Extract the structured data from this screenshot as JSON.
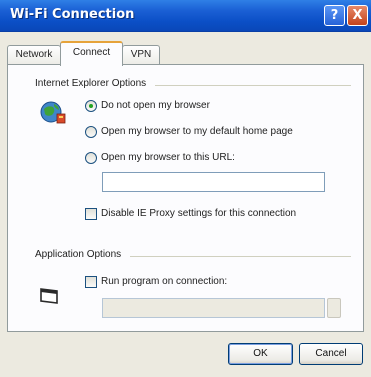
{
  "window": {
    "title": "Wi-Fi Connection",
    "help_label": "?",
    "close_label": "X"
  },
  "tabs": [
    {
      "label": "Network"
    },
    {
      "label": "Connect",
      "selected": true
    },
    {
      "label": "VPN"
    }
  ],
  "ie_group": {
    "title": "Internet Explorer Options",
    "icon": "ie-globe-icon",
    "options": [
      {
        "label": "Do not open my browser",
        "selected": true
      },
      {
        "label": "Open my browser to my default home page",
        "selected": false
      },
      {
        "label": "Open my browser to this URL:",
        "selected": false
      }
    ],
    "url_value": "",
    "proxy_checkbox": {
      "label": "Disable IE Proxy settings for this connection",
      "checked": false
    }
  },
  "app_group": {
    "title": "Application Options",
    "icon": "application-window-icon",
    "run_checkbox": {
      "label": "Run program on connection:",
      "checked": false
    },
    "program_value": ""
  },
  "buttons": {
    "ok": "OK",
    "cancel": "Cancel"
  }
}
